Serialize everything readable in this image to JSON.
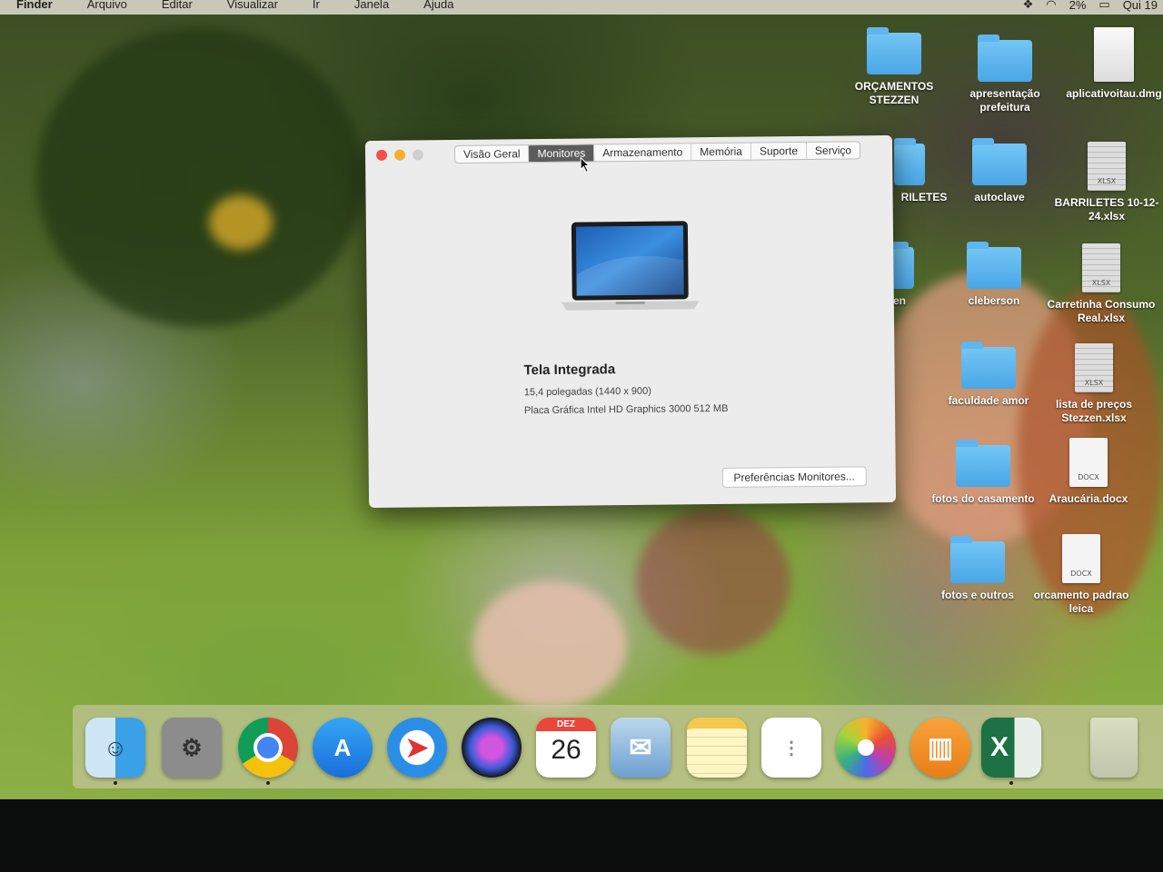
{
  "menubar": {
    "menus": [
      "Finder",
      "Arquivo",
      "Editar",
      "Visualizar",
      "Ir",
      "Janela",
      "Ajuda"
    ],
    "battery": "2%",
    "clock": "Qui 19"
  },
  "desktop_icons": [
    {
      "label": "ORÇAMENTOS STEZZEN",
      "type": "folder"
    },
    {
      "label": "apresentação prefeitura",
      "type": "folder"
    },
    {
      "label": "aplicativoitau.dmg",
      "type": "dmg"
    },
    {
      "label": "RILETES",
      "type": "folder"
    },
    {
      "label": "autoclave",
      "type": "folder"
    },
    {
      "label": "BARRILETES 10-12-24.xlsx",
      "type": "xlsx"
    },
    {
      "label": "zen",
      "type": "folder"
    },
    {
      "label": "cleberson",
      "type": "folder"
    },
    {
      "label": "Carretinha Consumo Real.xlsx",
      "type": "xlsx"
    },
    {
      "label": "faculdade amor",
      "type": "folder"
    },
    {
      "label": "lista de preços Stezzen.xlsx",
      "type": "xlsx"
    },
    {
      "label": "fotos do casamento",
      "type": "folder"
    },
    {
      "label": "Araucária.docx",
      "type": "docx"
    },
    {
      "label": "fotos e outros",
      "type": "folder"
    },
    {
      "label": "orcamento padrao leica",
      "type": "docx"
    }
  ],
  "doc_tags": {
    "xlsx": "XLSX",
    "docx": "DOCX"
  },
  "window": {
    "tabs": [
      "Visão Geral",
      "Monitores",
      "Armazenamento",
      "Memória",
      "Suporte",
      "Serviço"
    ],
    "active_tab": "Monitores",
    "display_name": "Tela Integrada",
    "display_size": "15,4 polegadas (1440 x 900)",
    "graphics": "Placa Gráfica Intel HD Graphics 3000 512 MB",
    "preferences_button": "Preferências Monitores..."
  },
  "dock": {
    "calendar_month": "DEZ",
    "calendar_day": "26",
    "apps": [
      "finder-icon",
      "system-preferences-icon",
      "chrome-icon",
      "app-store-icon",
      "safari-icon",
      "siri-icon",
      "calendar-icon",
      "mail-icon",
      "notes-icon",
      "reminders-icon",
      "photos-icon",
      "books-icon",
      "excel-icon",
      "trash-icon"
    ]
  }
}
